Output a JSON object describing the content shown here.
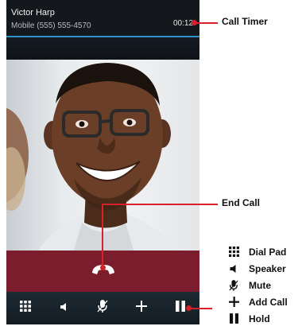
{
  "call": {
    "caller_name": "Victor Harp",
    "caller_number": "Mobile (555) 555-4570",
    "timer": "00:12"
  },
  "toolbar": {
    "items": [
      {
        "name": "dial-pad",
        "icon": "dialpad-icon"
      },
      {
        "name": "speaker",
        "icon": "speaker-icon"
      },
      {
        "name": "mute",
        "icon": "microphone-icon"
      },
      {
        "name": "add-call",
        "icon": "plus-icon"
      },
      {
        "name": "hold",
        "icon": "pause-icon"
      }
    ]
  },
  "end_call": {
    "icon": "hangup-icon",
    "color": "#7b1d2d"
  },
  "callouts": {
    "call_timer": "Call Timer",
    "end_call": "End Call"
  },
  "legend": {
    "dial_pad": "Dial Pad",
    "speaker": "Speaker",
    "mute": "Mute",
    "add_call": "Add Call",
    "hold": "Hold"
  },
  "colors": {
    "accent_line": "#2f8fc6",
    "callout_red": "#d8202a"
  }
}
